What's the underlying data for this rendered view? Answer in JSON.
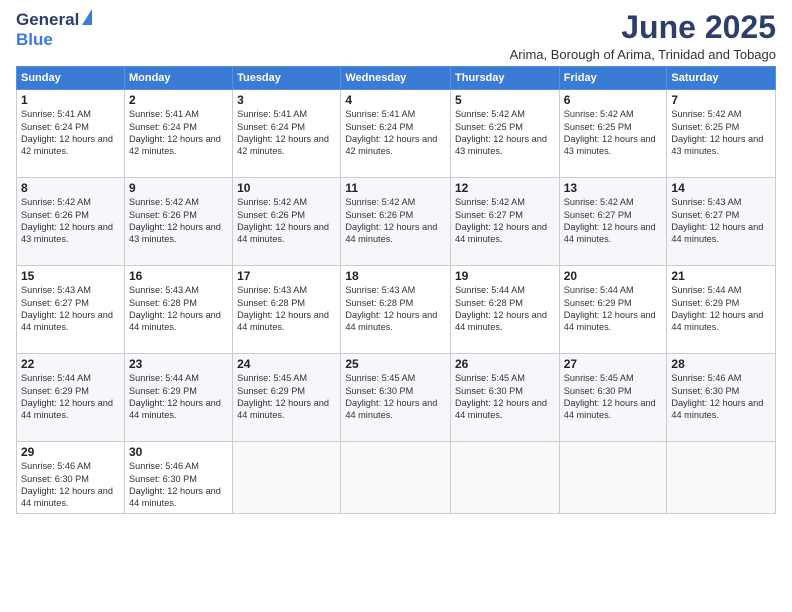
{
  "logo": {
    "general": "General",
    "blue": "Blue"
  },
  "title": "June 2025",
  "subtitle": "Arima, Borough of Arima, Trinidad and Tobago",
  "days_header": [
    "Sunday",
    "Monday",
    "Tuesday",
    "Wednesday",
    "Thursday",
    "Friday",
    "Saturday"
  ],
  "weeks": [
    [
      {
        "num": "1",
        "sunrise": "5:41 AM",
        "sunset": "6:24 PM",
        "daylight": "12 hours and 42 minutes."
      },
      {
        "num": "2",
        "sunrise": "5:41 AM",
        "sunset": "6:24 PM",
        "daylight": "12 hours and 42 minutes."
      },
      {
        "num": "3",
        "sunrise": "5:41 AM",
        "sunset": "6:24 PM",
        "daylight": "12 hours and 42 minutes."
      },
      {
        "num": "4",
        "sunrise": "5:41 AM",
        "sunset": "6:24 PM",
        "daylight": "12 hours and 42 minutes."
      },
      {
        "num": "5",
        "sunrise": "5:42 AM",
        "sunset": "6:25 PM",
        "daylight": "12 hours and 43 minutes."
      },
      {
        "num": "6",
        "sunrise": "5:42 AM",
        "sunset": "6:25 PM",
        "daylight": "12 hours and 43 minutes."
      },
      {
        "num": "7",
        "sunrise": "5:42 AM",
        "sunset": "6:25 PM",
        "daylight": "12 hours and 43 minutes."
      }
    ],
    [
      {
        "num": "8",
        "sunrise": "5:42 AM",
        "sunset": "6:26 PM",
        "daylight": "12 hours and 43 minutes."
      },
      {
        "num": "9",
        "sunrise": "5:42 AM",
        "sunset": "6:26 PM",
        "daylight": "12 hours and 43 minutes."
      },
      {
        "num": "10",
        "sunrise": "5:42 AM",
        "sunset": "6:26 PM",
        "daylight": "12 hours and 44 minutes."
      },
      {
        "num": "11",
        "sunrise": "5:42 AM",
        "sunset": "6:26 PM",
        "daylight": "12 hours and 44 minutes."
      },
      {
        "num": "12",
        "sunrise": "5:42 AM",
        "sunset": "6:27 PM",
        "daylight": "12 hours and 44 minutes."
      },
      {
        "num": "13",
        "sunrise": "5:42 AM",
        "sunset": "6:27 PM",
        "daylight": "12 hours and 44 minutes."
      },
      {
        "num": "14",
        "sunrise": "5:43 AM",
        "sunset": "6:27 PM",
        "daylight": "12 hours and 44 minutes."
      }
    ],
    [
      {
        "num": "15",
        "sunrise": "5:43 AM",
        "sunset": "6:27 PM",
        "daylight": "12 hours and 44 minutes."
      },
      {
        "num": "16",
        "sunrise": "5:43 AM",
        "sunset": "6:28 PM",
        "daylight": "12 hours and 44 minutes."
      },
      {
        "num": "17",
        "sunrise": "5:43 AM",
        "sunset": "6:28 PM",
        "daylight": "12 hours and 44 minutes."
      },
      {
        "num": "18",
        "sunrise": "5:43 AM",
        "sunset": "6:28 PM",
        "daylight": "12 hours and 44 minutes."
      },
      {
        "num": "19",
        "sunrise": "5:44 AM",
        "sunset": "6:28 PM",
        "daylight": "12 hours and 44 minutes."
      },
      {
        "num": "20",
        "sunrise": "5:44 AM",
        "sunset": "6:29 PM",
        "daylight": "12 hours and 44 minutes."
      },
      {
        "num": "21",
        "sunrise": "5:44 AM",
        "sunset": "6:29 PM",
        "daylight": "12 hours and 44 minutes."
      }
    ],
    [
      {
        "num": "22",
        "sunrise": "5:44 AM",
        "sunset": "6:29 PM",
        "daylight": "12 hours and 44 minutes."
      },
      {
        "num": "23",
        "sunrise": "5:44 AM",
        "sunset": "6:29 PM",
        "daylight": "12 hours and 44 minutes."
      },
      {
        "num": "24",
        "sunrise": "5:45 AM",
        "sunset": "6:29 PM",
        "daylight": "12 hours and 44 minutes."
      },
      {
        "num": "25",
        "sunrise": "5:45 AM",
        "sunset": "6:30 PM",
        "daylight": "12 hours and 44 minutes."
      },
      {
        "num": "26",
        "sunrise": "5:45 AM",
        "sunset": "6:30 PM",
        "daylight": "12 hours and 44 minutes."
      },
      {
        "num": "27",
        "sunrise": "5:45 AM",
        "sunset": "6:30 PM",
        "daylight": "12 hours and 44 minutes."
      },
      {
        "num": "28",
        "sunrise": "5:46 AM",
        "sunset": "6:30 PM",
        "daylight": "12 hours and 44 minutes."
      }
    ],
    [
      {
        "num": "29",
        "sunrise": "5:46 AM",
        "sunset": "6:30 PM",
        "daylight": "12 hours and 44 minutes."
      },
      {
        "num": "30",
        "sunrise": "5:46 AM",
        "sunset": "6:30 PM",
        "daylight": "12 hours and 44 minutes."
      },
      null,
      null,
      null,
      null,
      null
    ]
  ]
}
